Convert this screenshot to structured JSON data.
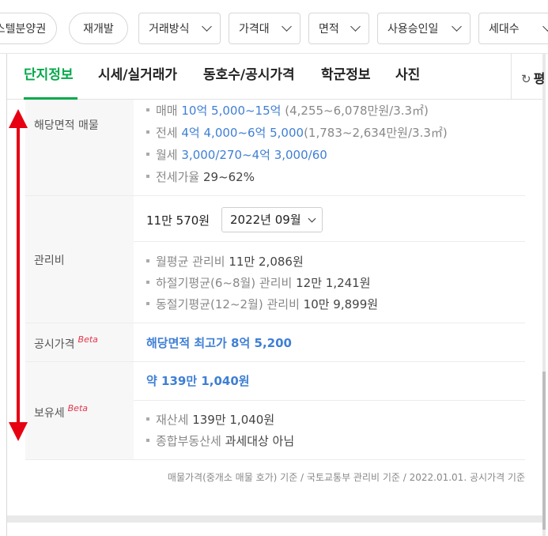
{
  "filters": [
    {
      "label": "스텔분양권",
      "dropdown": false
    },
    {
      "label": "재개발",
      "dropdown": false
    },
    {
      "label": "거래방식",
      "dropdown": true
    },
    {
      "label": "가격대",
      "dropdown": true
    },
    {
      "label": "면적",
      "dropdown": true
    },
    {
      "label": "사용승인일",
      "dropdown": true
    },
    {
      "label": "세대수",
      "dropdown": true
    }
  ],
  "tabs": [
    {
      "label": "단지정보",
      "active": true
    },
    {
      "label": "시세/실거래가",
      "active": false
    },
    {
      "label": "동호수/공시가격",
      "active": false
    },
    {
      "label": "학군정보",
      "active": false
    },
    {
      "label": "사진",
      "active": false
    }
  ],
  "refresh_label": "평",
  "listing": {
    "label": "해당면적 매물",
    "sale": {
      "kind": "매매",
      "range": "10억 5,000~15억",
      "per_area": "(4,255~6,078만원/3.3㎡)"
    },
    "jeonse": {
      "kind": "전세",
      "range": "4억 4,000~6억 5,000",
      "per_area": "(1,783~2,634만원/3.3㎡)"
    },
    "monthly": {
      "kind": "월세",
      "range": "3,000/270~4억 3,000/60"
    },
    "ratio": {
      "kind": "전세가율",
      "value": "29~62%"
    }
  },
  "maintenance": {
    "label": "관리비",
    "amount": "11만 570원",
    "month": "2022년 09월",
    "avg": {
      "label": "월평균 관리비",
      "value": "11만 2,086원"
    },
    "summer": {
      "label": "하절기평균(6~8월) 관리비",
      "value": "12만 1,241원"
    },
    "winter": {
      "label": "동절기평균(12~2월) 관리비",
      "value": "10만 9,899원"
    }
  },
  "public_price": {
    "label": "공시가격",
    "beta": "Beta",
    "value": "해당면적 최고가 8억 5,200"
  },
  "holding_tax": {
    "label": "보유세",
    "beta": "Beta",
    "total": "약 139만 1,040원",
    "property": {
      "label": "재산세",
      "value": "139만 1,040원"
    },
    "comprehensive": {
      "label": "종합부동산세",
      "value": "과세대상 아님"
    }
  },
  "footnote": "매물가격(중개소 매물 호가) 기준 / 국토교통부 관리비 기준 / 2022.01.01. 공시가격 기준",
  "colors": {
    "accent_green": "#03a94a",
    "link_blue": "#3f7fd5",
    "annotation_red": "#e60012"
  }
}
